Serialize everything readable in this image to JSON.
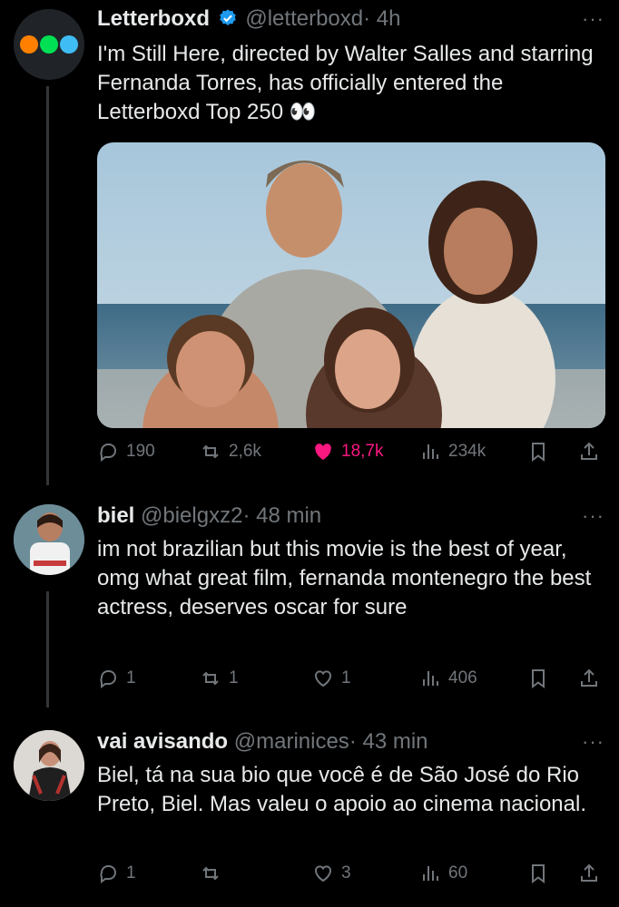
{
  "tweets": [
    {
      "name": "Letterboxd",
      "handle": "@letterboxd",
      "time": "· 4h",
      "text": "I'm Still Here, directed by Walter Salles and starring Fernanda Torres, has officially entered the Letterboxd Top 250 👀",
      "verified": true,
      "stats": {
        "replies": "190",
        "retweets": "2,6k",
        "likes": "18,7k",
        "views": "234k"
      },
      "liked": true,
      "colors": {
        "dot1": "#ff8000",
        "dot2": "#00e054",
        "dot3": "#40bcf4"
      }
    },
    {
      "name": "biel",
      "handle": "@bielgxz2",
      "time": "· 48 min",
      "text": "im not brazilian but this movie is the best of year, omg what great film, fernanda montenegro the best actress, deserves oscar for sure",
      "stats": {
        "replies": "1",
        "retweets": "1",
        "likes": "1",
        "views": "406"
      }
    },
    {
      "name": "vai avisando",
      "handle": "@marinices",
      "time": "· 43 min",
      "text": "Biel, tá na sua bio que você é de São José do Rio Preto, Biel. Mas valeu o apoio ao cinema nacional.",
      "stats": {
        "replies": "1",
        "retweets": "",
        "likes": "3",
        "views": "60"
      }
    }
  ],
  "more_icon": "···",
  "theme": {
    "like_color": "#f91880",
    "verified_color": "#1d9bf0"
  }
}
